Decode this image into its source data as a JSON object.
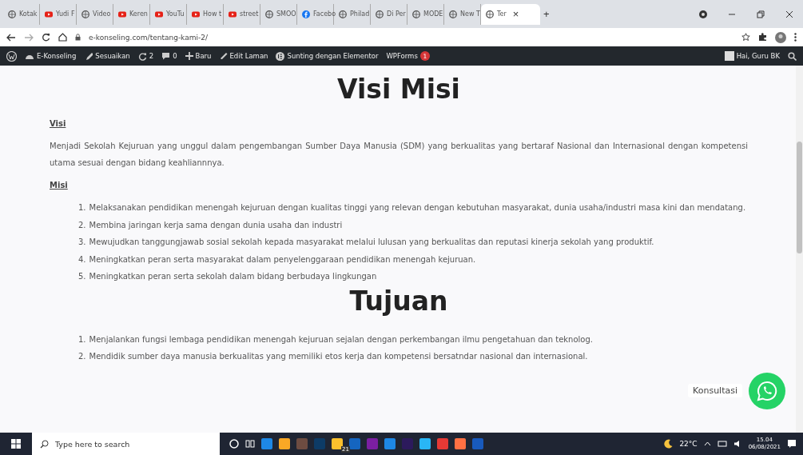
{
  "browser": {
    "tabs": [
      {
        "title": "Kotak",
        "kind": "globe",
        "selected": false
      },
      {
        "title": "Yudi F",
        "kind": "video",
        "selected": false
      },
      {
        "title": "Video",
        "kind": "globe",
        "selected": false
      },
      {
        "title": "Keren",
        "kind": "video",
        "selected": false
      },
      {
        "title": "YouTu",
        "kind": "video",
        "selected": false
      },
      {
        "title": "How t",
        "kind": "video",
        "selected": false
      },
      {
        "title": "street",
        "kind": "video",
        "selected": false
      },
      {
        "title": "SMOO",
        "kind": "globe",
        "selected": false
      },
      {
        "title": "Facebo",
        "kind": "social",
        "selected": false
      },
      {
        "title": "Philad",
        "kind": "globe",
        "selected": false
      },
      {
        "title": "Di Per",
        "kind": "globe",
        "selected": false
      },
      {
        "title": "MODE",
        "kind": "globe",
        "selected": false
      },
      {
        "title": "New T",
        "kind": "globe",
        "selected": false
      },
      {
        "title": "Ter",
        "kind": "globe",
        "selected": true
      }
    ],
    "close_tab": "×",
    "new_tab": "+",
    "url": "e-konseling.com/tentang-kami-2/"
  },
  "admin_bar": {
    "site": "E-Konseling",
    "customize": "Sesuaikan",
    "updates": "2",
    "comments": "0",
    "new": "Baru",
    "edit": "Edit Laman",
    "elementor": "Sunting dengan Elementor",
    "wpforms": "WPForms",
    "wpforms_badge": "1",
    "greeting": "Hai, Guru BK"
  },
  "page": {
    "title": "Visi Misi",
    "vision_heading": "Visi",
    "vision_text": "Menjadi Sekolah Kejuruan yang unggul dalam pengembangan Sumber Daya Manusia (SDM) yang berkualitas yang bertaraf Nasional dan Internasional dengan kompetensi utama sesuai dengan bidang keahliannnya.",
    "mission_heading": "Misi",
    "missions": [
      {
        "number": "1.",
        "text": "Melaksanakan pendidikan menengah kejuruan dengan kualitas tinggi yang relevan dengan kebutuhan masyarakat, dunia usaha/industri masa kini dan mendatang."
      },
      {
        "number": "2.",
        "text": "Membina jaringan kerja sama dengan dunia usaha dan industri"
      },
      {
        "number": "3.",
        "text": "Mewujudkan tanggungjawab sosial sekolah kepada masyarakat melalui lulusan yang berkualitas dan reputasi kinerja sekolah yang produktif."
      },
      {
        "number": "4.",
        "text": "Meningkatkan peran serta masyarakat dalam penyelenggaraan pendidikan menengah kejuruan."
      },
      {
        "number": "5.",
        "text": "Meningkatkan peran serta sekolah dalam bidang berbudaya lingkungan"
      }
    ],
    "goals_title": "Tujuan",
    "goals": [
      {
        "number": "1.",
        "text": "Menjalankan fungsi lembaga pendidikan menengah kejuruan sejalan dengan perkembangan ilmu pengetahuan dan teknolog."
      },
      {
        "number": "2.",
        "text": "Mendidik sumber daya manusia berkualitas yang memiliki etos kerja dan kompetensi bersatndar nasional dan internasional."
      }
    ],
    "chat_label": "Konsultasi"
  },
  "taskbar": {
    "search_placeholder": "Type here to search",
    "apps": [
      {
        "color": "#1e88e5"
      },
      {
        "color": "#f9a825"
      },
      {
        "color": "#6d4c41"
      },
      {
        "color": "#0d3b66"
      },
      {
        "color": "#fbc02d"
      },
      {
        "color": "#1565c0"
      },
      {
        "color": "#7b1fa2"
      },
      {
        "color": "#1e88e5"
      },
      {
        "color": "#2c1a5c"
      },
      {
        "color": "#29b6f6"
      },
      {
        "color": "#e53935"
      },
      {
        "color": "#ff7043"
      },
      {
        "color": "#185abd"
      }
    ],
    "mail_badge": "21",
    "temperature": "22°C",
    "time": "15.04",
    "date": "06/08/2021"
  }
}
